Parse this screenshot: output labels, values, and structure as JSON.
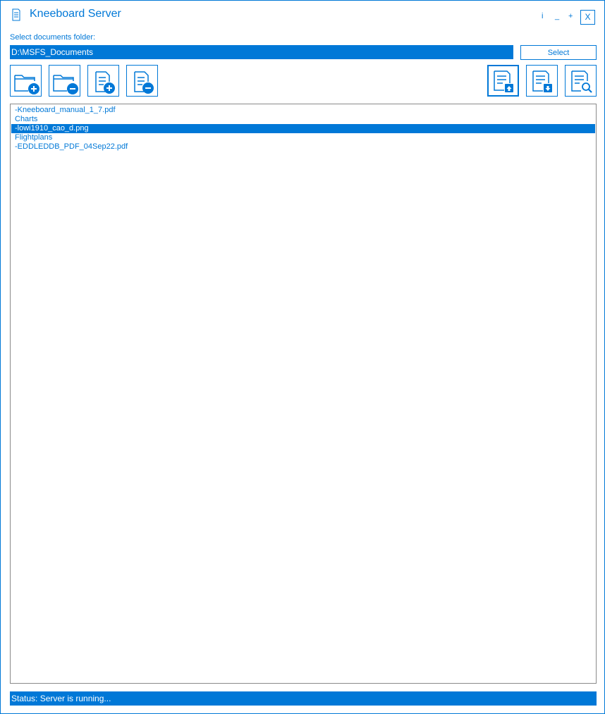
{
  "window": {
    "title": "Kneeboard Server",
    "info_label": "i",
    "minimize_label": "_",
    "maximize_label": "+",
    "close_label": "X"
  },
  "folder": {
    "label": "Select documents folder:",
    "value": "D:\\MSFS_Documents",
    "select_label": "Select"
  },
  "toolbar": {
    "left": [
      {
        "icon": "folder-add-icon"
      },
      {
        "icon": "folder-remove-icon"
      },
      {
        "icon": "document-add-icon"
      },
      {
        "icon": "document-remove-icon"
      }
    ],
    "right": [
      {
        "icon": "document-upload-icon",
        "active": true
      },
      {
        "icon": "document-download-icon"
      },
      {
        "icon": "document-search-icon"
      }
    ]
  },
  "files": [
    {
      "label": "-Kneeboard_manual_1_7.pdf",
      "selected": false
    },
    {
      "label": "Charts",
      "selected": false
    },
    {
      "label": "-lowi1910_cao_d.png",
      "selected": true
    },
    {
      "label": "Flightplans",
      "selected": false
    },
    {
      "label": "-EDDLEDDB_PDF_04Sep22.pdf",
      "selected": false
    }
  ],
  "status": {
    "text": "Status: Server is running..."
  },
  "colors": {
    "accent": "#0078d7",
    "border_gray": "#8a8a8a",
    "background": "#ffffff"
  }
}
